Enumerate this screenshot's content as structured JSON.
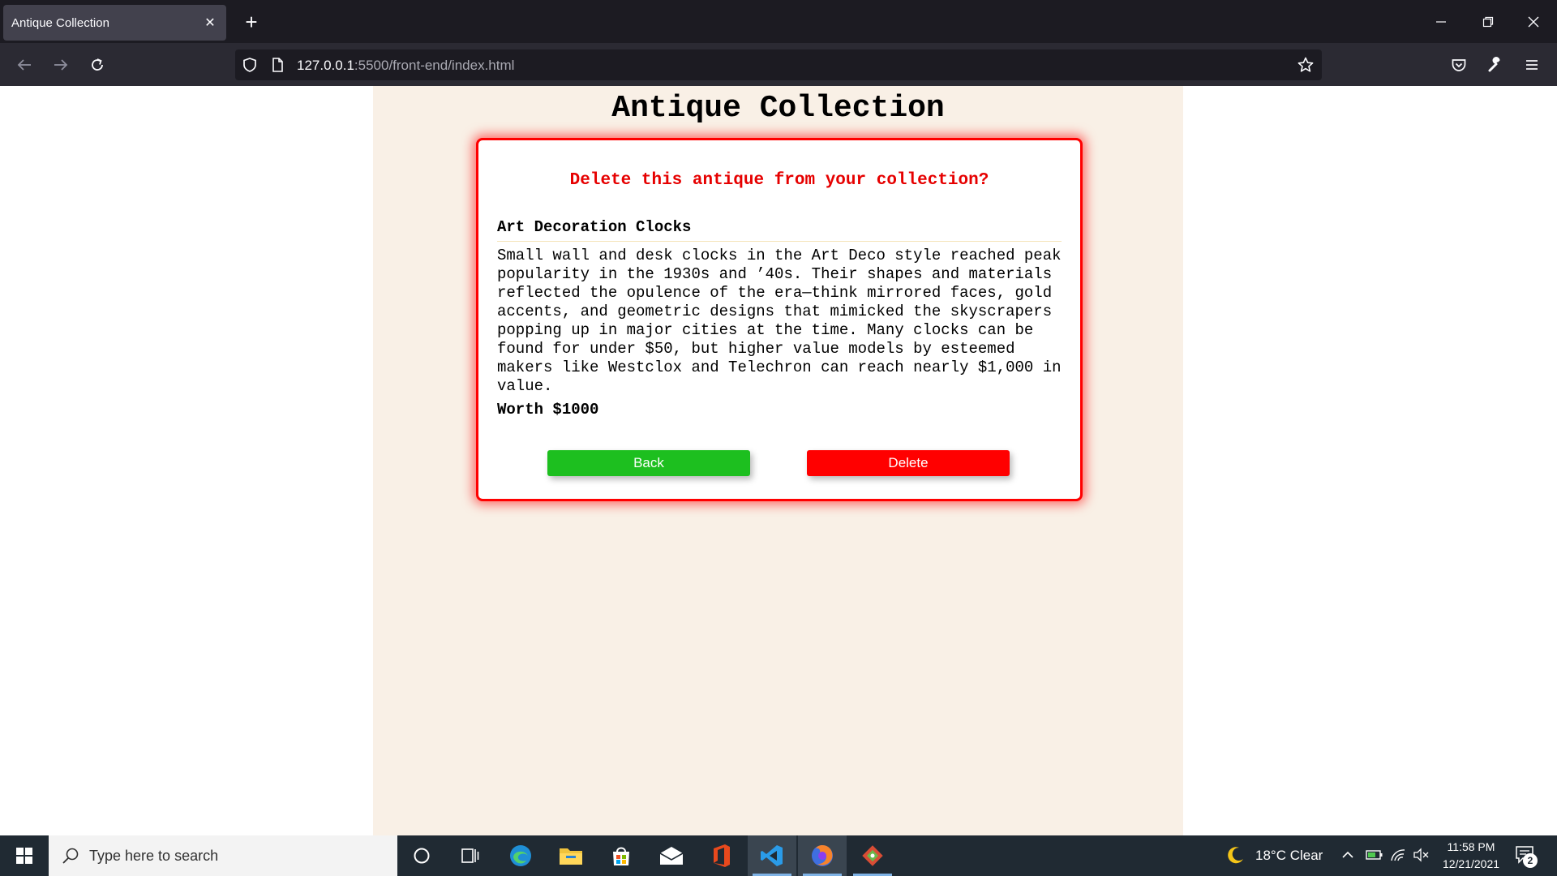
{
  "browser": {
    "tab_title": "Antique Collection",
    "tab_close": "✕",
    "new_tab": "+",
    "url_host": "127.0.0.1",
    "url_rest": ":5500/front-end/index.html"
  },
  "page": {
    "title": "Antique Collection"
  },
  "dialog": {
    "question": "Delete this antique from your collection?",
    "item_name": "Art Decoration Clocks",
    "description": "Small wall and desk clocks in the Art Deco style reached peak popularity in the 1930s and ’40s. Their shapes and materials reflected the opulence of the era—think mirrored faces, gold accents, and geometric designs that mimicked the skyscrapers popping up in major cities at the time. Many clocks can be found for under $50, but higher value models by esteemed makers like Westclox and Telechron can reach nearly $1,000 in value.",
    "worth": "Worth $1000",
    "back_label": "Back",
    "delete_label": "Delete",
    "back_color": "#1dbf1f",
    "delete_color": "#ff0000"
  },
  "taskbar": {
    "search_placeholder": "Type here to search",
    "weather": "18°C  Clear",
    "time": "11:58 PM",
    "date": "12/21/2021",
    "notification_count": "2"
  },
  "icons": [
    "back-arrow-icon",
    "forward-arrow-icon",
    "reload-icon",
    "shield-icon",
    "page-icon",
    "star-icon",
    "pocket-icon",
    "wrench-icon",
    "menu-icon",
    "windows-start-icon",
    "search-icon",
    "cortana-icon",
    "task-view-icon",
    "edge-icon",
    "file-explorer-icon",
    "store-icon",
    "mail-icon",
    "office-icon",
    "vscode-icon",
    "firefox-icon",
    "git-icon",
    "moon-icon",
    "chevron-up-icon",
    "battery-icon",
    "wifi-icon",
    "volume-muted-icon",
    "notification-icon"
  ]
}
